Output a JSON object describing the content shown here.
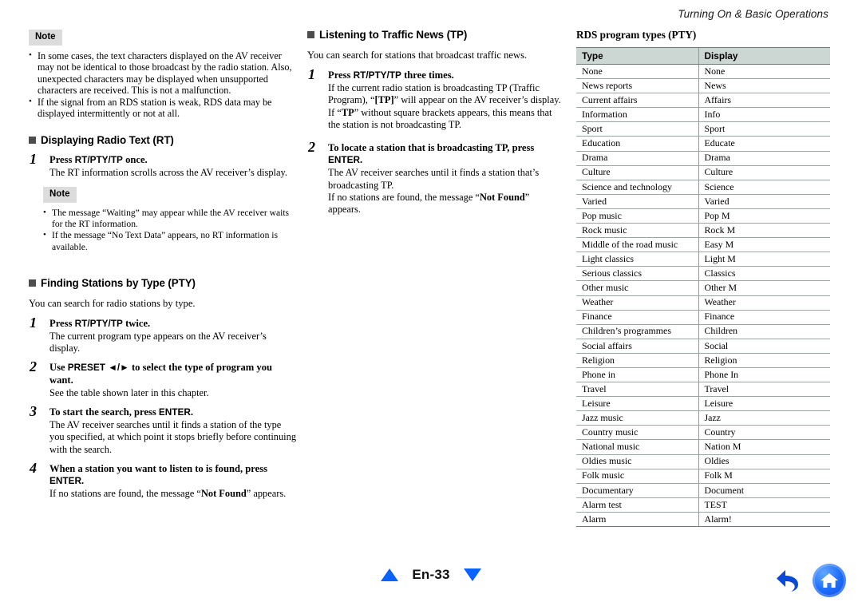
{
  "header": {
    "running_title": "Turning On & Basic Operations"
  },
  "left_column": {
    "note_top": {
      "label": "Note",
      "items": [
        "In some cases, the text characters displayed on the AV receiver may not be identical to those broadcast by the radio station. Also, unexpected characters may be displayed when unsupported characters are received. This is not a malfunction.",
        "If the signal from an RDS station is weak, RDS data may be displayed intermittently or not at all."
      ]
    },
    "section_rt": {
      "heading": "Displaying Radio Text (RT)",
      "steps": [
        {
          "num": "1",
          "title_pre": "Press ",
          "title_key": "RT/PTY/TP",
          "title_post": " once.",
          "body": "The RT information scrolls across the AV receiver’s display."
        }
      ],
      "note_inner": {
        "label": "Note",
        "items": [
          "The message “Waiting” may appear while the AV receiver waits for the RT information.",
          "If the message “No Text Data” appears, no RT information is available."
        ]
      }
    },
    "section_pty": {
      "heading": "Finding Stations by Type (PTY)",
      "lead": "You can search for radio stations by type.",
      "steps": [
        {
          "num": "1",
          "title_pre": "Press ",
          "title_key": "RT/PTY/TP",
          "title_post": " twice.",
          "body": "The current program type appears on the AV receiver’s display."
        },
        {
          "num": "2",
          "title_pre": "Use ",
          "title_key": "PRESET ◄/►",
          "title_post": " to select the type of program you want.",
          "body": "See the table shown later in this chapter."
        },
        {
          "num": "3",
          "title_pre": "To start the search, press ",
          "title_key": "ENTER",
          "title_post": ".",
          "body": "The AV receiver searches until it finds a station of the type you specified, at which point it stops briefly before continuing with the search."
        },
        {
          "num": "4",
          "title_pre": "When a station you want to listen to is found, press ",
          "title_key": "ENTER",
          "title_post": ".",
          "body_pre": "If no stations are found, the message “",
          "body_bold": "Not Found",
          "body_post": "” appears."
        }
      ]
    }
  },
  "middle_column": {
    "section_tp": {
      "heading": "Listening to Traffic News (TP)",
      "lead": "You can search for stations that broadcast traffic news.",
      "steps": [
        {
          "num": "1",
          "title_pre": "Press ",
          "title_key": "RT/PTY/TP",
          "title_post": " three times.",
          "body_1": "If the current radio station is broadcasting TP (Traffic Program), “",
          "body_bold_1": "[TP]",
          "body_2": "” will appear on the AV receiver’s display. If “",
          "body_bold_2": "TP",
          "body_3": "” without square brackets appears, this means that the station is not broadcasting TP."
        },
        {
          "num": "2",
          "title_pre": "To locate a station that is broadcasting TP, press ",
          "title_key": "ENTER",
          "title_post": ".",
          "body_1": "The AV receiver searches until it finds a station that’s broadcasting TP.",
          "body_pre": "If no stations are found, the message “",
          "body_bold": "Not Found",
          "body_post": "” appears."
        }
      ]
    }
  },
  "right_column": {
    "table_title": "RDS program types (PTY)",
    "table": {
      "columns": [
        "Type",
        "Display"
      ],
      "rows": [
        [
          "None",
          "None"
        ],
        [
          "News reports",
          "News"
        ],
        [
          "Current affairs",
          "Affairs"
        ],
        [
          "Information",
          "Info"
        ],
        [
          "Sport",
          "Sport"
        ],
        [
          "Education",
          "Educate"
        ],
        [
          "Drama",
          "Drama"
        ],
        [
          "Culture",
          "Culture"
        ],
        [
          "Science and technology",
          "Science"
        ],
        [
          "Varied",
          "Varied"
        ],
        [
          "Pop music",
          "Pop M"
        ],
        [
          "Rock music",
          "Rock M"
        ],
        [
          "Middle of the road music",
          "Easy M"
        ],
        [
          "Light classics",
          "Light M"
        ],
        [
          "Serious classics",
          "Classics"
        ],
        [
          "Other music",
          "Other M"
        ],
        [
          "Weather",
          "Weather"
        ],
        [
          "Finance",
          "Finance"
        ],
        [
          "Children’s programmes",
          "Children"
        ],
        [
          "Social affairs",
          "Social"
        ],
        [
          "Religion",
          "Religion"
        ],
        [
          "Phone in",
          "Phone In"
        ],
        [
          "Travel",
          "Travel"
        ],
        [
          "Leisure",
          "Leisure"
        ],
        [
          "Jazz music",
          "Jazz"
        ],
        [
          "Country music",
          "Country"
        ],
        [
          "National music",
          "Nation M"
        ],
        [
          "Oldies music",
          "Oldies"
        ],
        [
          "Folk music",
          "Folk M"
        ],
        [
          "Documentary",
          "Document"
        ],
        [
          "Alarm test",
          "TEST"
        ],
        [
          "Alarm",
          "Alarm!"
        ]
      ]
    }
  },
  "footer": {
    "page_label": "En-33",
    "prev_icon": "triangle-up-icon",
    "next_icon": "triangle-down-icon",
    "back_icon": "back-arrow-icon",
    "home_icon": "home-icon",
    "accent_color": "#0a63ff"
  }
}
